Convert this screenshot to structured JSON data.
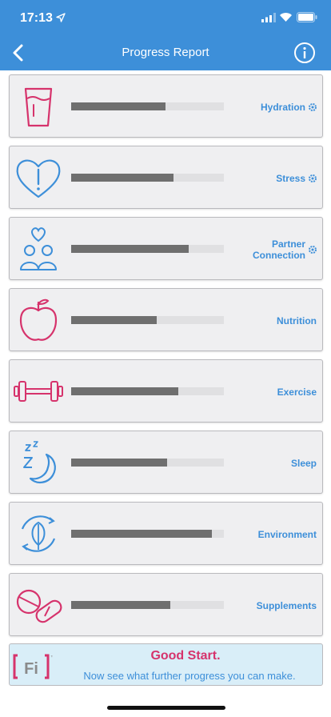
{
  "status": {
    "time": "17:13"
  },
  "nav": {
    "title": "Progress Report"
  },
  "items": [
    {
      "label": "Hydration",
      "progress": 0.62,
      "has_gear": true,
      "icon": "glass-icon"
    },
    {
      "label": "Stress",
      "progress": 0.67,
      "has_gear": true,
      "icon": "heart-alert-icon"
    },
    {
      "label": "Partner Connection",
      "progress": 0.77,
      "has_gear": true,
      "icon": "couple-icon"
    },
    {
      "label": "Nutrition",
      "progress": 0.56,
      "has_gear": false,
      "icon": "apple-icon"
    },
    {
      "label": "Exercise",
      "progress": 0.7,
      "has_gear": false,
      "icon": "dumbbell-icon"
    },
    {
      "label": "Sleep",
      "progress": 0.63,
      "has_gear": false,
      "icon": "moon-zzz-icon"
    },
    {
      "label": "Environment",
      "progress": 0.92,
      "has_gear": false,
      "icon": "leaf-cycle-icon"
    },
    {
      "label": "Supplements",
      "progress": 0.65,
      "has_gear": false,
      "icon": "pills-icon"
    }
  ],
  "banner": {
    "headline": "Good Start.",
    "subtext": "Now see what further progress you can make.",
    "logo_text": "Fi",
    "logo_tm": "™"
  },
  "colors": {
    "accent": "#3d8fd9",
    "icon_pink": "#d6336c",
    "bar_fill": "#6f6f6f",
    "bar_track": "#e0e0e2"
  }
}
